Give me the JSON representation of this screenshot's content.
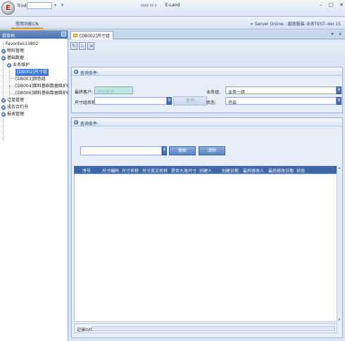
{
  "titlebar": {
    "tcode_label": "Tcode",
    "tcode_value": "",
    "window_title": "E-Land",
    "controls": [
      "–",
      "□",
      "✕"
    ]
  },
  "ribbon": {
    "favorites_tab": "常用功能CN",
    "server_text": "Server Online : 越南服装-业务TEST--Ver.15"
  },
  "left_panel": {
    "header": "菜单树",
    "tree": {
      "favorites": "Favorites13802",
      "n1": "物料管理",
      "n2": "基础数据",
      "n2_1": "业务维护",
      "n2_1_1": "[DB002]尺寸组",
      "n2_1_2": "[DB003]颜色组",
      "n2_1_3": "[DB004]面料基础数据维护(新)",
      "n2_1_4": "[DB006]辅料基础数据维护(新)",
      "n3": "订单管理",
      "n4": "成衣合约书",
      "n5": "报表管理"
    }
  },
  "doc": {
    "tab_label": "[DB002]尺寸组",
    "tab_controls": "▾ x"
  },
  "query_panel": {
    "title": "查询条件:",
    "customer_label": "最终客户:",
    "customer_placeholder": "除开查询",
    "size_group_label": "尺寸组名称:",
    "size_group_value": "",
    "query_btn": "查询",
    "business_label": "业务组:",
    "business_value": "业务一组",
    "status_label": "状态:",
    "status_value": "开启"
  },
  "result_panel": {
    "title": "查询条件:",
    "filter_value": "",
    "search_btn": "搜索",
    "clear_btn": "清除",
    "columns": [
      "序号",
      "尺寸编码",
      "尺寸名称",
      "尺寸英文名称",
      "是否大身尺寸",
      "创建人",
      "创建日期",
      "最后修改人",
      "最后修改日期",
      "状态"
    ],
    "record_text": "记录0/0"
  },
  "colors": {
    "grid_header": "#3f67a6",
    "panel_border": "#9cb2d4",
    "selected_node": "#3c78d8"
  }
}
